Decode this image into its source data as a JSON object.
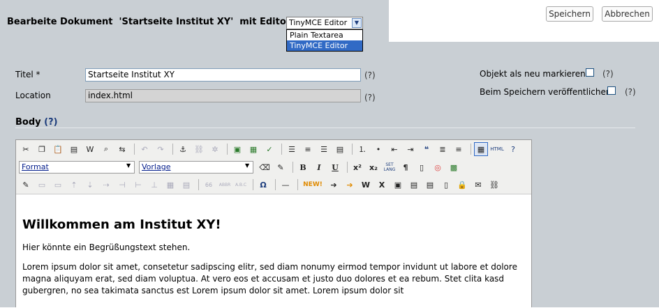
{
  "header": {
    "title": "Bearbeite Dokument  'Startseite Institut XY'  mit Editor",
    "editor_select": {
      "value": "TinyMCE Editor",
      "options": [
        "Plain Textarea",
        "TinyMCE Editor"
      ]
    },
    "save_label": "Speichern",
    "cancel_label": "Abbrechen"
  },
  "form": {
    "title_label": "Titel *",
    "title_value": "Startseite Institut XY",
    "title_help": "(?)",
    "location_label": "Location",
    "location_value": "index.html",
    "location_help": "(?)",
    "mark_new_label": "Objekt als neu markieren",
    "mark_new_help": "(?)",
    "publish_label": "Beim Speichern veröffentlichen",
    "publish_help": "(?)"
  },
  "body_section": {
    "label": "Body",
    "help": "(?)"
  },
  "toolbar": {
    "format_select": "Format",
    "template_select": "Vorlage",
    "new_label": "NEW!",
    "lang_label": "SET LANG"
  },
  "content": {
    "heading": "Willkommen am Institut XY!",
    "paragraph1": "Hier könnte ein Begrüßungstext stehen.",
    "paragraph2": "Lorem ipsum dolor sit amet, consetetur sadipscing elitr, sed diam nonumy eirmod tempor invidunt ut labore et dolore magna aliquyam erat, sed diam voluptua. At vero eos et accusam et justo duo dolores et ea rebum. Stet clita kasd gubergren, no sea takimata sanctus est Lorem ipsum dolor sit amet. Lorem ipsum dolor sit"
  },
  "colors": {
    "panel": "#c9cfd4",
    "selection": "#316ac5",
    "link_blue": "#1c3c7c"
  }
}
